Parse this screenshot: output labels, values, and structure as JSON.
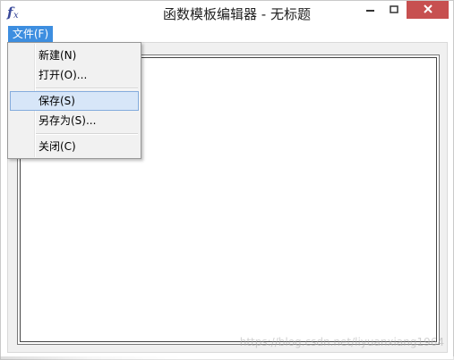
{
  "window": {
    "title": "函数模板编辑器 - 无标题",
    "close_color": "#c75050"
  },
  "menubar": {
    "items": [
      {
        "label": "文件(F)",
        "active": true
      }
    ],
    "accent": "#3d8ee0"
  },
  "file_menu": {
    "items": [
      {
        "label": "新建(N)"
      },
      {
        "label": "打开(O)..."
      },
      {
        "label": "保存(S)",
        "highlighted": true
      },
      {
        "label": "另存为(S)..."
      },
      {
        "label": "关闭(C)"
      }
    ],
    "highlight_color": "#d7e6f8"
  },
  "watermark": "https://blog.csdn.net/liyuanxiang1964",
  "icons": {
    "app": "function-fx-icon",
    "minimize": "minimize-icon",
    "maximize": "maximize-icon",
    "close": "close-icon"
  }
}
